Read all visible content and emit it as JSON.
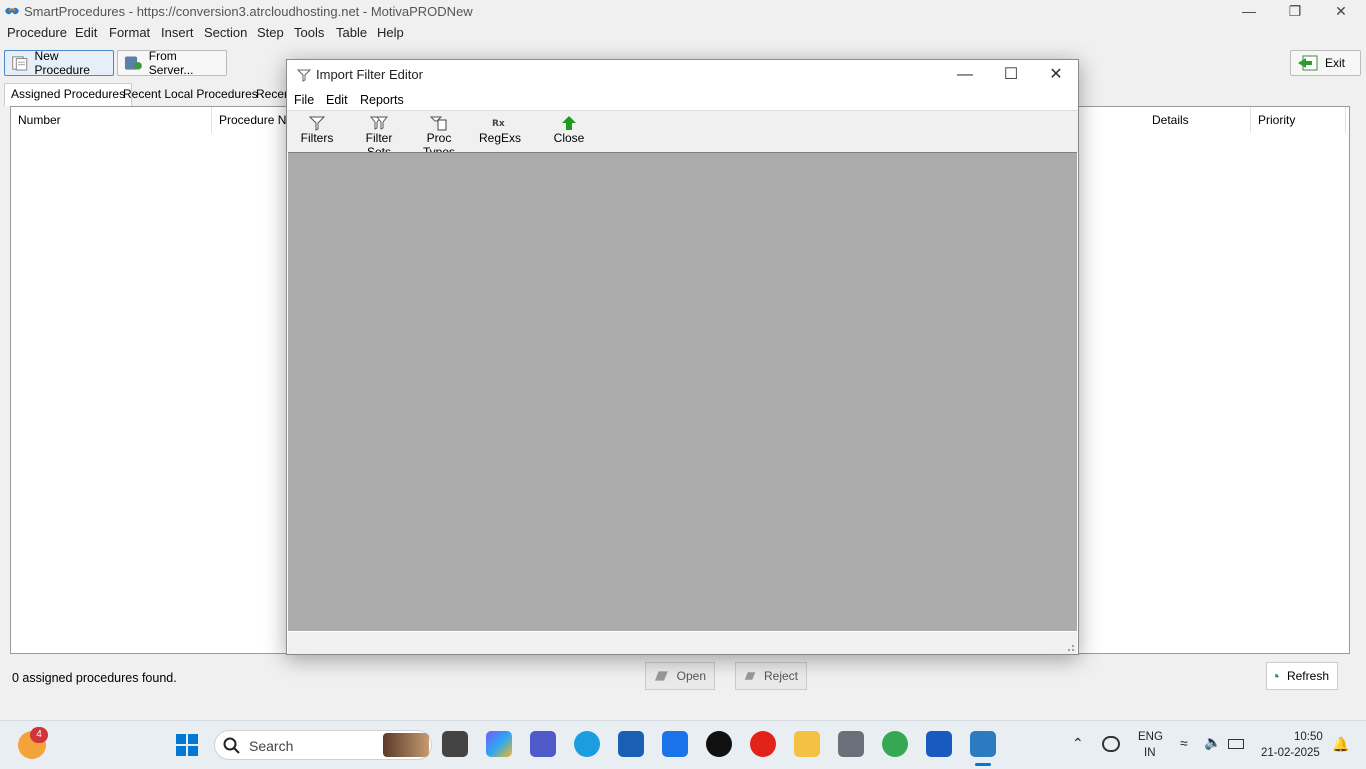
{
  "window": {
    "title": "SmartProcedures - https://conversion3.atrcloudhosting.net - MotivaPRODNew"
  },
  "menu": [
    "Procedure",
    "Edit",
    "Format",
    "Insert",
    "Section",
    "Step",
    "Tools",
    "Table",
    "Help"
  ],
  "toolbar": {
    "new_procedure": "New Procedure",
    "from_server": "From Server...",
    "exit": "Exit"
  },
  "tabs": [
    "Assigned Procedures",
    "Recent Local Procedures",
    "Recen"
  ],
  "columns": [
    "Number",
    "Procedure Nar",
    "Details",
    "Priority"
  ],
  "status": "0 assigned procedures found.",
  "buttons": {
    "open": "Open",
    "reject": "Reject",
    "refresh": "Refresh"
  },
  "dialog": {
    "title": "Import Filter Editor",
    "menu": [
      "File",
      "Edit",
      "Reports"
    ],
    "tools": [
      "Filters",
      "Filter Sets",
      "Proc Types",
      "RegExs",
      "Close"
    ]
  },
  "taskbar": {
    "search_placeholder": "Search",
    "notification_count": "4",
    "lang_top": "ENG",
    "lang_bottom": "IN",
    "time": "10:50",
    "date": "21-02-2025"
  },
  "colors": {
    "dialog_body": "#ababab",
    "accent": "#0078d4"
  }
}
